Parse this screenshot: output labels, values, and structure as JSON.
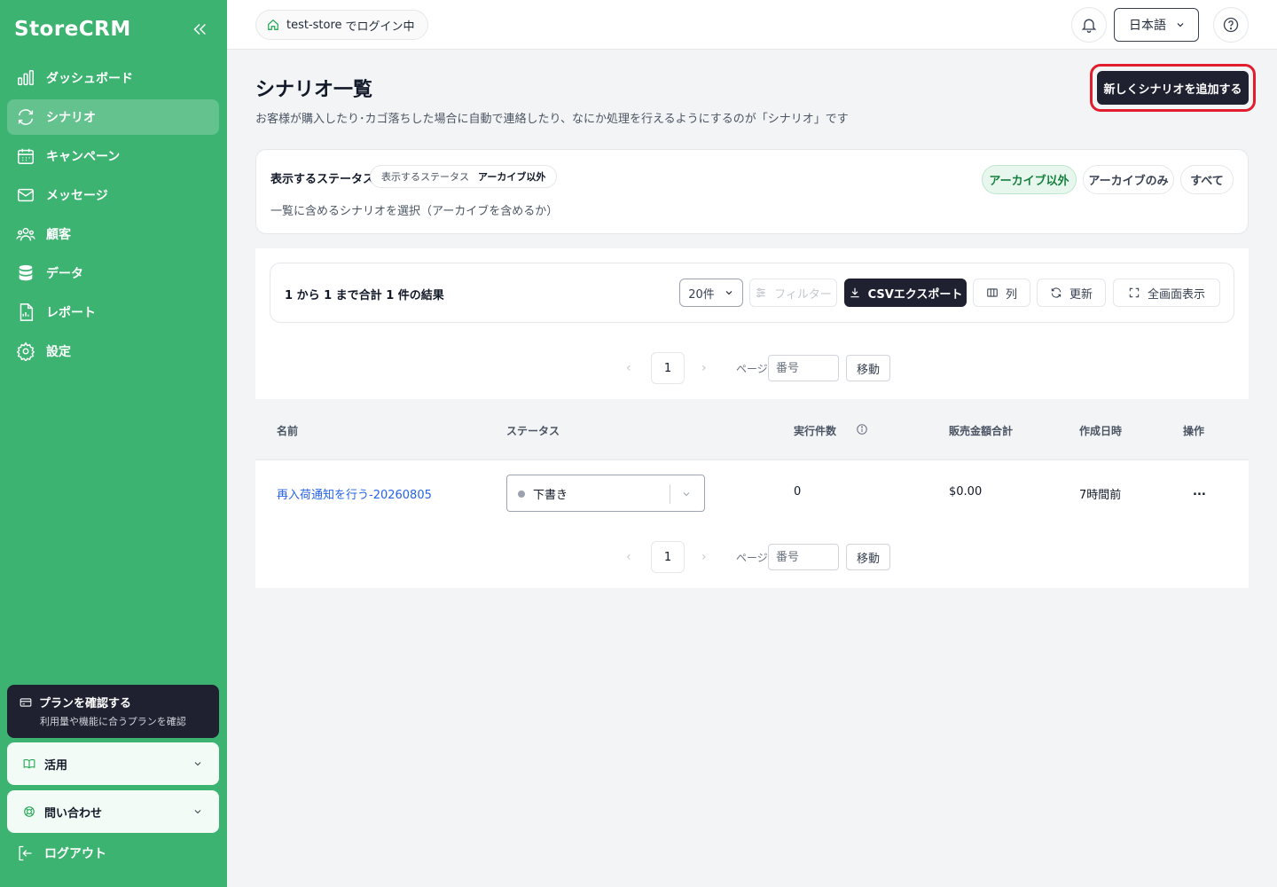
{
  "app": {
    "name": "StoreCRM"
  },
  "sidebar": {
    "items": [
      {
        "label": "ダッシュボード",
        "icon": "bar-chart-icon"
      },
      {
        "label": "シナリオ",
        "icon": "refresh-cycle-icon",
        "active": true
      },
      {
        "label": "キャンペーン",
        "icon": "calendar-icon"
      },
      {
        "label": "メッセージ",
        "icon": "mail-icon"
      },
      {
        "label": "顧客",
        "icon": "users-icon"
      },
      {
        "label": "データ",
        "icon": "database-icon"
      },
      {
        "label": "レポート",
        "icon": "file-report-icon"
      },
      {
        "label": "設定",
        "icon": "gear-icon"
      }
    ],
    "plan": {
      "title": "プランを確認する",
      "subtitle": "利用量や機能に合うプランを確認"
    },
    "usage": {
      "label": "活用"
    },
    "contact": {
      "label": "問い合わせ"
    },
    "logout": {
      "label": "ログアウト"
    }
  },
  "topbar": {
    "store_name": "test-store",
    "store_suffix": "でログイン中",
    "language": "日本語"
  },
  "page": {
    "title": "シナリオ一覧",
    "description": "お客様が購入したり･カゴ落ちした場合に自動で連絡したり、なにか処理を行えるようにするのが「シナリオ」です",
    "add_button": "新しくシナリオを追加する"
  },
  "status_filter": {
    "label": "表示するステータス",
    "pill_key": "表示するステータス",
    "pill_value": "アーカイブ以外",
    "hint": "一覧に含めるシナリオを選択（アーカイブを含めるか）",
    "options": [
      "アーカイブ以外",
      "アーカイブのみ",
      "すべて"
    ],
    "selected": "アーカイブ以外"
  },
  "toolbar": {
    "result_text": "1 から 1 まで合計 1 件の結果",
    "page_size": "20件",
    "filter": "フィルター",
    "csv_export": "CSVエクスポート",
    "columns": "列",
    "refresh": "更新",
    "fullscreen": "全画面表示"
  },
  "pagination": {
    "current_page": "1",
    "page_label": "ページ",
    "input_placeholder": "番号",
    "go_button": "移動"
  },
  "table": {
    "columns": [
      "名前",
      "ステータス",
      "実行件数",
      "販売金額合計",
      "作成日時",
      "操作"
    ],
    "rows": [
      {
        "name": "再入荷通知を行う-20260805",
        "status": "下書き",
        "executions": "0",
        "sales_total": "$0.00",
        "created": "7時間前",
        "actions": "..."
      }
    ]
  },
  "colors": {
    "sidebar_bg": "#3cb371",
    "dark_button": "#1f2130",
    "highlight_border": "#e11d2e",
    "link": "#2563eb",
    "selected_segment": "#15803d"
  }
}
